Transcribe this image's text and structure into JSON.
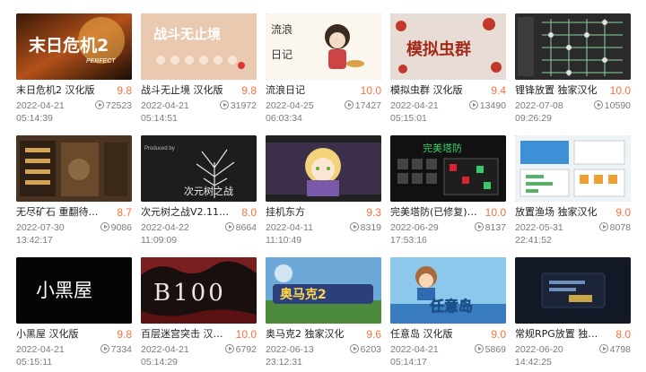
{
  "games": [
    {
      "title": "末日危机2 汉化版",
      "score": "9.8",
      "date": "2022-04-21",
      "time": "05:14:39",
      "plays": "72523",
      "icon": "thumb-doomsday-crisis"
    },
    {
      "title": "战斗无止境 汉化版",
      "score": "9.8",
      "date": "2022-04-21",
      "time": "05:14:51",
      "plays": "31972",
      "icon": "thumb-endless-battle"
    },
    {
      "title": "流浪日记",
      "score": "10.0",
      "date": "2022-04-25",
      "time": "06:03:34",
      "plays": "17427",
      "icon": "thumb-wandering-diary"
    },
    {
      "title": "模拟虫群 汉化版",
      "score": "9.4",
      "date": "2022-04-21",
      "time": "05:15:01",
      "plays": "13490",
      "icon": "thumb-insect-swarm"
    },
    {
      "title": "锂锋放置 独家汉化",
      "score": "10.0",
      "date": "2022-07-08",
      "time": "09:26:29",
      "plays": "10590",
      "icon": "thumb-idle-grid"
    },
    {
      "title": "无尽矿石 重翻待发布",
      "score": "8.7",
      "date": "2022-07-30",
      "time": "13:42:17",
      "plays": "9086",
      "icon": "thumb-endless-ore"
    },
    {
      "title": "次元树之战V2.11 (需",
      "score": "8.0",
      "date": "2022-04-22",
      "time": "11:09:09",
      "plays": "8664",
      "icon": "thumb-dimension-tree"
    },
    {
      "title": "挂机东方",
      "score": "9.3",
      "date": "2022-04-11",
      "time": "11:10:49",
      "plays": "8319",
      "icon": "thumb-idle-touhou"
    },
    {
      "title": "完美塔防(已修复) 独",
      "score": "10.0",
      "date": "2022-06-29",
      "time": "17:53:16",
      "plays": "8137",
      "icon": "thumb-perfect-td"
    },
    {
      "title": "放置渔场 独家汉化",
      "score": "9.0",
      "date": "2022-05-31",
      "time": "22:41:52",
      "plays": "8078",
      "icon": "thumb-idle-fishery"
    },
    {
      "title": "小黑屋 汉化版",
      "score": "9.8",
      "date": "2022-04-21",
      "time": "05:15:11",
      "plays": "7334",
      "icon": "thumb-dark-room"
    },
    {
      "title": "百层迷宫突击 汉化版",
      "score": "10.0",
      "date": "2022-04-21",
      "time": "05:14:29",
      "plays": "6792",
      "icon": "thumb-b100"
    },
    {
      "title": "奥马克2 独家汉化",
      "score": "9.6",
      "date": "2022-06-13",
      "time": "23:12:31",
      "plays": "6203",
      "icon": "thumb-omake2"
    },
    {
      "title": "任意岛 汉化版",
      "score": "9.0",
      "date": "2022-04-21",
      "time": "05:14:17",
      "plays": "5869",
      "icon": "thumb-any-island"
    },
    {
      "title": "常规RPG放置 独家汉化",
      "score": "8.0",
      "date": "2022-06-20",
      "time": "14:42:25",
      "plays": "4798",
      "icon": "thumb-idle-rpg"
    }
  ],
  "thumb_text": {
    "t0": "末日危机2",
    "t0b": "PERFECT",
    "t1": "战斗无止境",
    "t2a": "流浪",
    "t2b": "日记",
    "t3": "模拟虫群",
    "t5": "",
    "t6a": "次元树之战",
    "t6b": "Produced by",
    "t8": "完美塔防",
    "t10": "小黑屋",
    "t11": "B100",
    "t12": "奥马克2",
    "t13": "任意岛"
  }
}
